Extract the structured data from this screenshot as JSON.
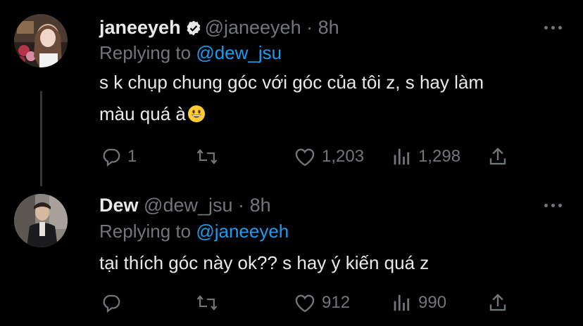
{
  "tweets": [
    {
      "name": "janeeyeh",
      "verified": true,
      "handle": "@janeeyeh",
      "separator": "·",
      "time": "8h",
      "replying_prefix": "Replying to",
      "replying_to": "@dew_jsu",
      "text_line1": "s k chụp chung góc với góc của tôi z, s hay làm",
      "text_line2": "màu quá à",
      "emoji": "grinning-face-emoji",
      "replies": "1",
      "retweets": "",
      "likes": "1,203",
      "views": "1,298"
    },
    {
      "name": "Dew",
      "verified": false,
      "handle": "@dew_jsu",
      "separator": "·",
      "time": "8h",
      "replying_prefix": "Replying to",
      "replying_to": "@janeeyeh",
      "text_line1": "tại thích góc này ok?? s hay ý kiến quá z",
      "replies": "",
      "retweets": "",
      "likes": "912",
      "views": "990"
    }
  ],
  "colors": {
    "background": "#000000",
    "text": "#e7e9ea",
    "muted": "#71767b",
    "link": "#1d9bf0",
    "thread_line": "#333639"
  },
  "icons": [
    "verified-badge-icon",
    "more-icon",
    "reply-icon",
    "retweet-icon",
    "like-icon",
    "views-icon",
    "share-icon"
  ]
}
